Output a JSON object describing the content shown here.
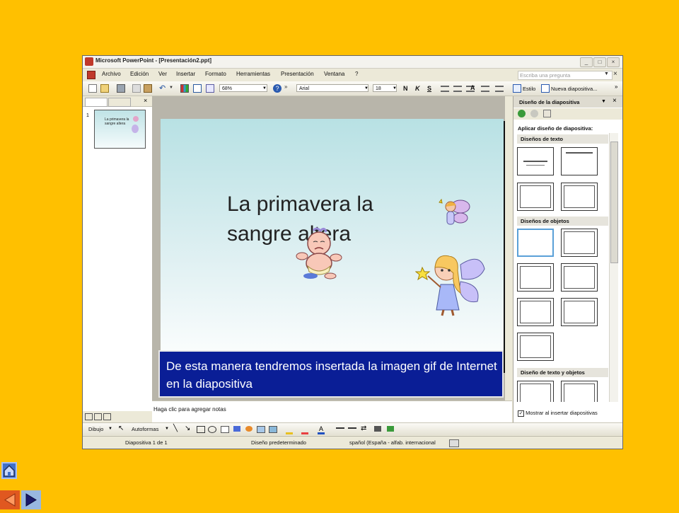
{
  "window": {
    "title": "Microsoft PowerPoint - [Presentación2.ppt]"
  },
  "menubar": {
    "items": [
      "Archivo",
      "Edición",
      "Ver",
      "Insertar",
      "Formato",
      "Herramientas",
      "Presentación",
      "Ventana",
      "?"
    ],
    "question_placeholder": "Escriba una pregunta"
  },
  "toolbar": {
    "zoom": "68%",
    "font": "Arial",
    "font_size": "18",
    "bold": "N",
    "italic": "K",
    "underline": "S",
    "style_label": "Estilo",
    "new_slide_label": "Nueva diapositiva..."
  },
  "slide_panel": {
    "slide_number": "1",
    "thumb_title": "La primavera la sangre altera"
  },
  "slide": {
    "title": "La primavera la sangre altera"
  },
  "notes": {
    "placeholder": "Haga clic para agregar notas"
  },
  "task_pane": {
    "title": "Diseño de la diapositiva",
    "apply_label": "Aplicar diseño de diapositiva:",
    "sections": [
      "Diseños de texto",
      "Diseños de objetos",
      "Diseño de texto y objetos"
    ],
    "show_on_insert": "Mostrar al insertar diapositivas"
  },
  "drawing_bar": {
    "draw_label": "Dibujo",
    "autoshapes_label": "Autoformas"
  },
  "statusbar": {
    "slide_info": "Diapositiva 1 de 1",
    "design": "Diseño predeterminado",
    "language": "spañol (España - alfab. internacional"
  },
  "caption": {
    "text": "De esta manera tendremos insertada la imagen gif de Internet en la diapositiva"
  },
  "colors": {
    "background": "#FFC000",
    "caption_bg": "#0A1E96",
    "home_button": "#4070C8",
    "prev_button": "#E05820",
    "next_button": "#98B8E0"
  }
}
